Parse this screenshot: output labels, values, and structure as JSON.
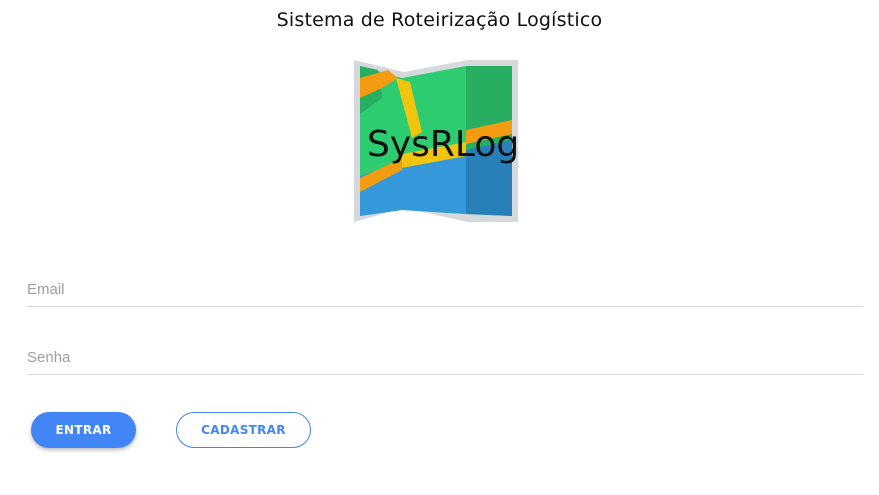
{
  "header": {
    "title": "Sistema de Roteirização Logístico"
  },
  "logo": {
    "text": "SysRLog",
    "icon": "folded-map-icon",
    "colors": {
      "green": "#2ecc71",
      "dark_green": "#27ae60",
      "blue": "#3498db",
      "dark_blue": "#2980b9",
      "road": "#f1c40f",
      "road_orange": "#f39c12",
      "frame": "#d5d8dc"
    }
  },
  "form": {
    "email_placeholder": "Email",
    "email_value": "",
    "password_placeholder": "Senha",
    "password_value": ""
  },
  "buttons": {
    "login_label": "ENTRAR",
    "register_label": "CADASTRAR"
  },
  "colors": {
    "primary": "#4285f4",
    "divider": "#d9d9d9",
    "placeholder": "#9e9e9e"
  }
}
